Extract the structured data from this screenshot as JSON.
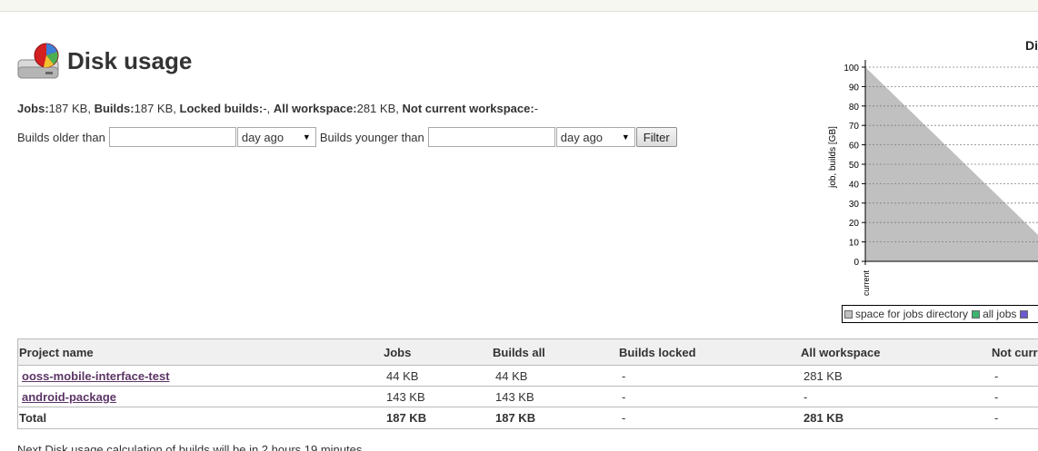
{
  "page": {
    "title": "Disk usage"
  },
  "summary": {
    "jobs_label": "Jobs:",
    "jobs_value": "187 KB",
    "builds_label": "Builds:",
    "builds_value": "187 KB",
    "locked_label": "Locked builds:",
    "locked_value": "-",
    "workspace_label": "All workspace:",
    "workspace_value": "281 KB",
    "not_current_label": "Not current workspace:",
    "not_current_value": "-"
  },
  "filter": {
    "older_label": "Builds older than",
    "older_value": "",
    "older_unit": "day ago",
    "younger_label": "Builds younger than",
    "younger_value": "",
    "younger_unit": "day ago",
    "button_label": "Filter"
  },
  "chart_data": {
    "type": "area",
    "title": "Di",
    "ylabel": "job, builds [GB]",
    "ylim": [
      0,
      100
    ],
    "yticks": [
      "0",
      "10",
      "20",
      "30",
      "40",
      "50",
      "60",
      "70",
      "80",
      "90",
      "100"
    ],
    "categories": [
      "current"
    ],
    "grid": true,
    "series": [
      {
        "name": "space for jobs directory",
        "color": "#c0c0c0",
        "values": [
          100
        ]
      },
      {
        "name": "all jobs",
        "color": "#3cb371",
        "values": [
          0
        ]
      },
      {
        "name": "",
        "color": "#6a5acd",
        "values": [
          0
        ]
      }
    ],
    "legend_placement": "bottom"
  },
  "table": {
    "headers": [
      "Project name",
      "Jobs",
      "Builds all",
      "Builds locked",
      "All workspace",
      "Not curre"
    ],
    "rows": [
      {
        "name": "ooss-mobile-interface-test",
        "jobs": "44 KB",
        "builds": "44 KB",
        "locked": "-",
        "workspace": "281 KB",
        "not_current": "-"
      },
      {
        "name": "android-package",
        "jobs": "143 KB",
        "builds": "143 KB",
        "locked": "-",
        "workspace": "-",
        "not_current": "-"
      }
    ],
    "total": {
      "name": "Total",
      "jobs": "187 KB",
      "builds": "187 KB",
      "locked": "-",
      "workspace": "281 KB",
      "not_current": "-"
    }
  },
  "footnote": "Next Disk usage calculation of builds will be in 2 hours 19 minutes"
}
